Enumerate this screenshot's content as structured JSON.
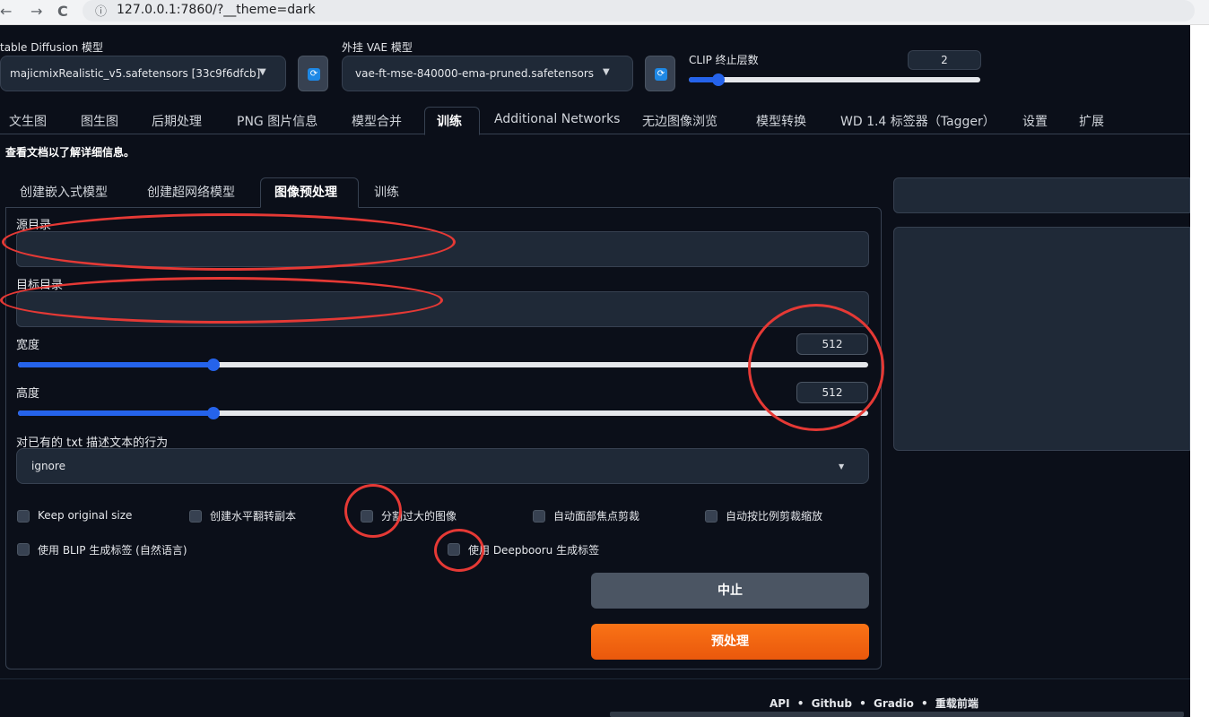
{
  "browser": {
    "back": "←",
    "forward": "→",
    "reload": "C",
    "info": "ⓘ",
    "url": "127.0.0.1:7860/?__theme=dark"
  },
  "top": {
    "sd_model_label": "table Diffusion 模型",
    "sd_model_value": "majicmixRealistic_v5.safetensors [33c9f6dfcb]",
    "vae_label": "外挂 VAE 模型",
    "vae_value": "vae-ft-mse-840000-ema-pruned.safetensors",
    "clip_label": "CLIP 终止层数",
    "clip_value": "2",
    "clip_fraction": 0.1,
    "refresh_glyph": "⟳",
    "arrow_glyph": "▼"
  },
  "main_tabs": [
    "文生图",
    "图生图",
    "后期处理",
    "PNG 图片信息",
    "模型合并",
    "训练",
    "Additional Networks",
    "无边图像浏览",
    "模型转换",
    "WD 1.4 标签器（Tagger）",
    "设置",
    "扩展"
  ],
  "doc_line": "查看文档以了解详细信息。",
  "sub_tabs": [
    "创建嵌入式模型",
    "创建超网络模型",
    "图像预处理",
    "训练"
  ],
  "form": {
    "source_dir_label": "源目录",
    "target_dir_label": "目标目录",
    "width_label": "宽度",
    "width_value": "512",
    "width_fraction": 0.23,
    "height_label": "高度",
    "height_value": "512",
    "height_fraction": 0.23,
    "caption_behavior_label": "对已有的 txt 描述文本的行为",
    "caption_behavior_value": "ignore",
    "checkboxes": [
      "Keep original size",
      "创建水平翻转副本",
      "分割过大的图像",
      "自动面部焦点剪裁",
      "自动按比例剪裁缩放",
      "使用 BLIP 生成标签 (自然语言)",
      "使用 Deepbooru 生成标签"
    ],
    "stop_button": "中止",
    "preprocess_button": "预处理"
  },
  "footer": {
    "links": [
      "API",
      "Github",
      "Gradio",
      "重载前端"
    ],
    "separator": "•"
  },
  "colors": {
    "accent_blue": "#2563eb",
    "accent_orange": "#f97316",
    "annotation_red": "#e53935",
    "background": "#0b0f19"
  }
}
